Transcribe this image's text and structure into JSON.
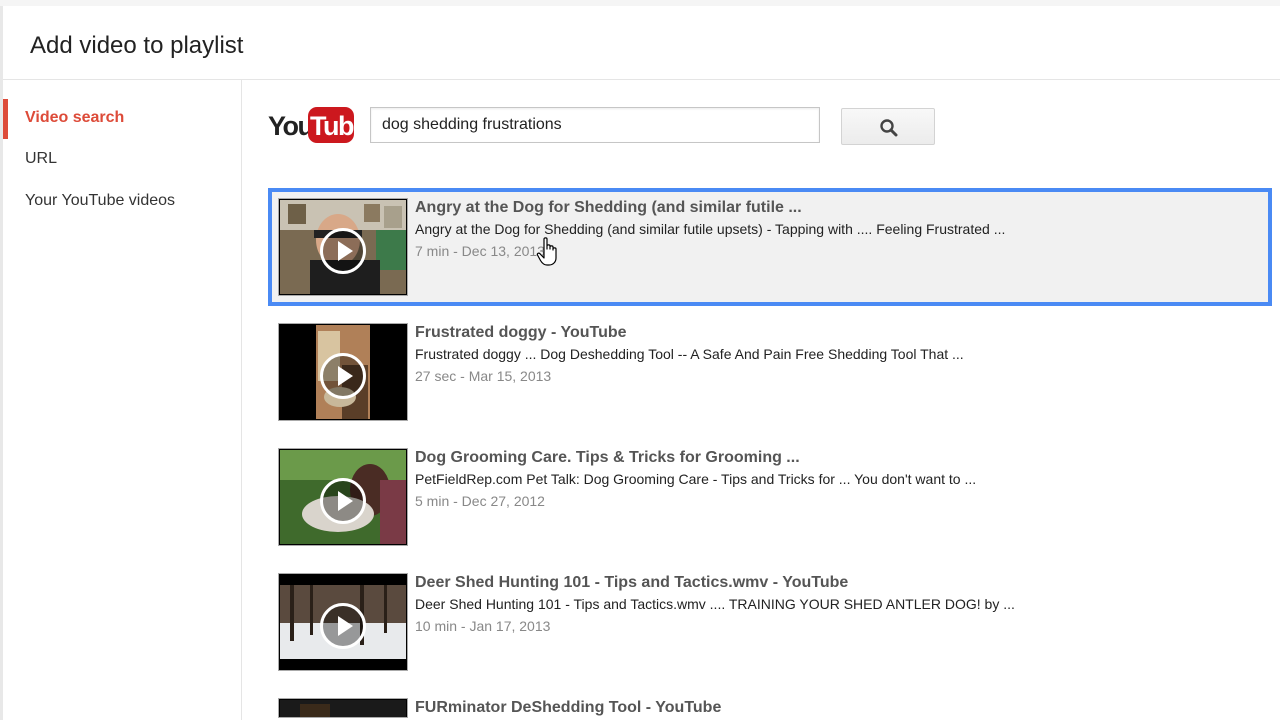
{
  "dialog": {
    "title": "Add video to playlist"
  },
  "sidebar": {
    "items": [
      {
        "label": "Video search",
        "active": true
      },
      {
        "label": "URL",
        "active": false
      },
      {
        "label": "Your YouTube videos",
        "active": false
      }
    ]
  },
  "logo": {
    "part1": "You",
    "part2": "Tube",
    "brand_color": "#cc181e"
  },
  "search": {
    "query": "dog shedding frustrations",
    "button_icon": "search-icon"
  },
  "results": [
    {
      "title": "Angry at the Dog for Shedding (and similar futile ...",
      "description": "Angry at the Dog for Shedding (and similar futile upsets) - Tapping with .... Feeling Frustrated ...",
      "meta": "7 min - Dec 13, 2013",
      "selected": true
    },
    {
      "title": "Frustrated doggy - YouTube",
      "description": "Frustrated doggy ... Dog Deshedding Tool -- A Safe And Pain Free Shedding Tool That ...",
      "meta": "27 sec - Mar 15, 2013",
      "selected": false
    },
    {
      "title": "Dog Grooming Care. Tips & Tricks for Grooming ...",
      "description": "PetFieldRep.com Pet Talk: Dog Grooming Care - Tips and Tricks for ... You don't want to ...",
      "meta": "5 min - Dec 27, 2012",
      "selected": false
    },
    {
      "title": "Deer Shed Hunting 101 - Tips and Tactics.wmv - YouTube",
      "description": "Deer Shed Hunting 101 - Tips and Tactics.wmv .... TRAINING YOUR SHED ANTLER DOG! by ...",
      "meta": "10 min - Jan 17, 2013",
      "selected": false
    },
    {
      "title": "FURminator DeShedding Tool - YouTube",
      "description": "",
      "meta": "",
      "selected": false
    }
  ],
  "colors": {
    "accent_red": "#dd4b39",
    "selection_blue": "#4a8af4"
  }
}
